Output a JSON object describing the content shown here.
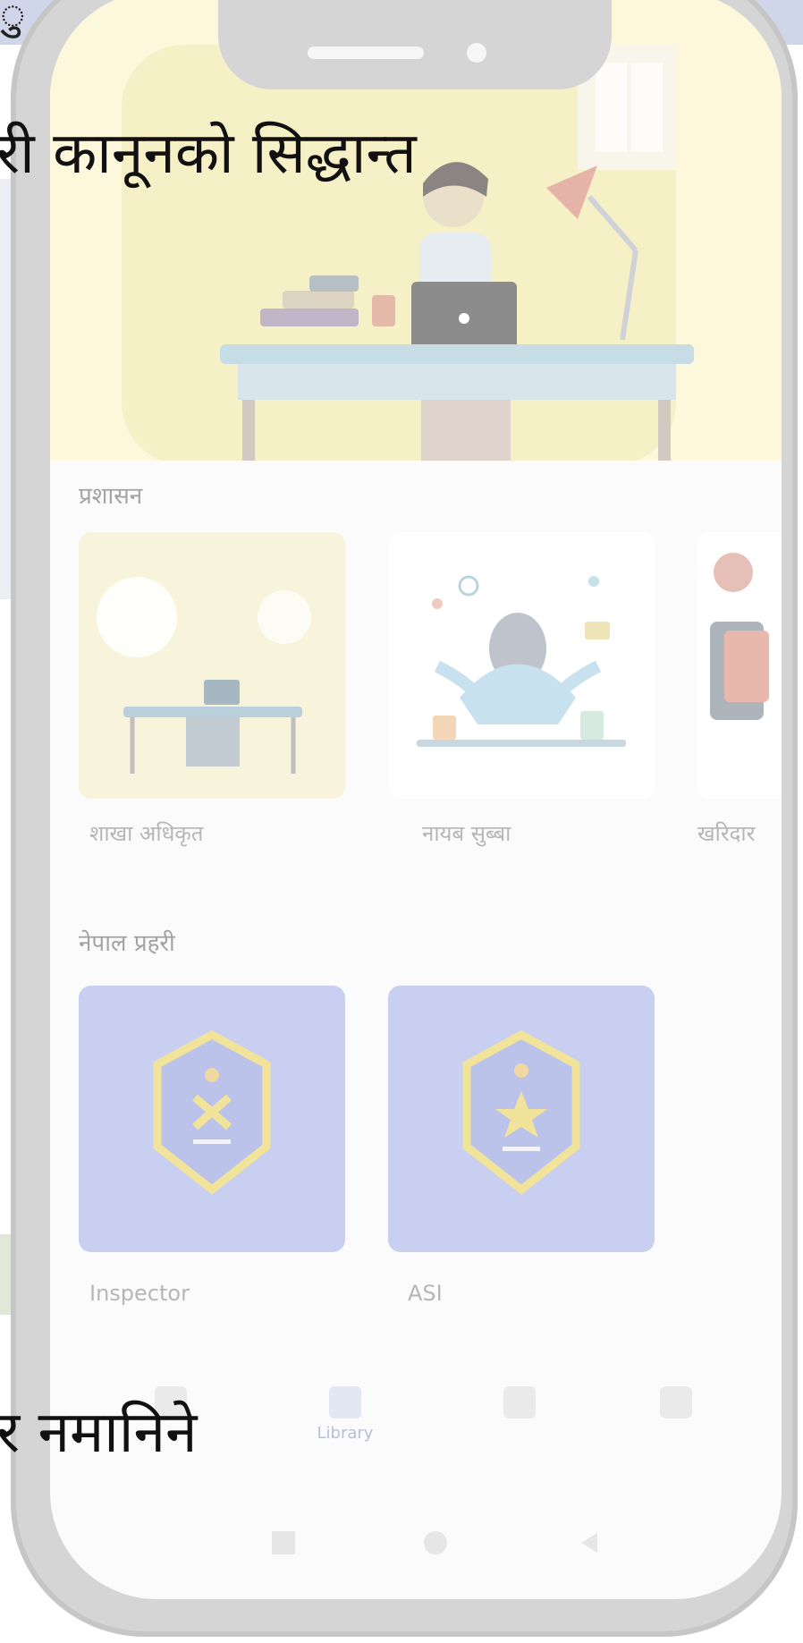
{
  "background_text": {
    "top_glyph": "ु",
    "line1": "री कानूनको सिद्धान्त",
    "line2": "र नमानिने"
  },
  "app": {
    "sections": [
      {
        "title": "प्रशासन",
        "cards": [
          {
            "label": "शाखा अधिकृत",
            "icon": "office-desk-illustration"
          },
          {
            "label": "नायब सुब्बा",
            "icon": "multitasking-woman-illustration"
          },
          {
            "label": "खरिदार",
            "icon": "reading-person-illustration"
          }
        ]
      },
      {
        "title": "नेपाल प्रहरी",
        "cards": [
          {
            "label": "Inspector",
            "icon": "police-badge-icon"
          },
          {
            "label": "ASI",
            "icon": "police-badge-icon"
          }
        ]
      }
    ],
    "bottom_nav": [
      {
        "label": "",
        "icon": "home-icon"
      },
      {
        "label": "Library",
        "icon": "library-icon"
      },
      {
        "label": "",
        "icon": "bookmark-icon"
      },
      {
        "label": "",
        "icon": "profile-icon"
      }
    ],
    "system_nav": {
      "icons": [
        "recents-icon",
        "home-circle-icon",
        "back-triangle-icon"
      ]
    }
  },
  "colors": {
    "hero_bg": "#fdf8dc",
    "badge_card_bg": "#c9cff0",
    "badge_gold": "#f1e39a"
  }
}
